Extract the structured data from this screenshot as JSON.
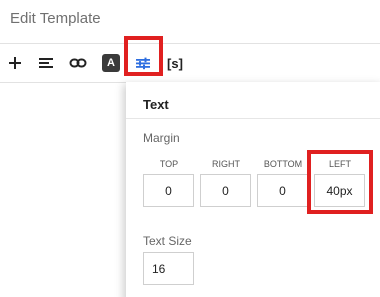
{
  "page_title": "Edit Template",
  "toolbar": {
    "bold_badge": "A",
    "variable_label": "[s]"
  },
  "panel": {
    "header": "Text",
    "margin": {
      "label": "Margin",
      "columns": [
        {
          "label": "TOP",
          "value": "0"
        },
        {
          "label": "RIGHT",
          "value": "0"
        },
        {
          "label": "BOTTOM",
          "value": "0"
        },
        {
          "label": "LEFT",
          "value": "40px"
        }
      ]
    },
    "text_size": {
      "label": "Text Size",
      "value": "16"
    }
  },
  "colors": {
    "highlight": "#e02020",
    "settings_icon": "#2f6fe0"
  }
}
